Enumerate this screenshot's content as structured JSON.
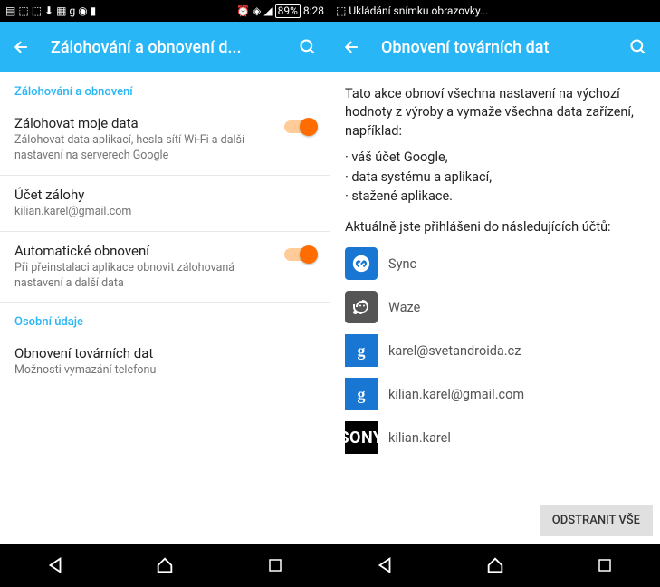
{
  "status": {
    "battery": "89%",
    "time": "8:28",
    "saving": "Ukládání snímku obrazovky..."
  },
  "left": {
    "title": "Zálohování a obnovení d...",
    "cat1": "Zálohování a obnovení",
    "backup": {
      "title": "Zálohovat moje data",
      "desc": "Zálohovat data aplikací, hesla sítí Wi-Fi a další nastavení na serverech Google"
    },
    "account": {
      "title": "Účet zálohy",
      "desc": "kilian.karel@gmail.com"
    },
    "autorestore": {
      "title": "Automatické obnovení",
      "desc": "Při přeinstalaci aplikace obnovit zálohovaná nastavení a další data"
    },
    "cat2": "Osobní údaje",
    "factory": {
      "title": "Obnovení továrních dat",
      "desc": "Možnosti vymazání telefonu"
    }
  },
  "right": {
    "title": "Obnovení továrních dat",
    "para": "Tato akce obnoví všechna nastavení na výchozí hodnoty z výroby a vymaže všechna data zařízení, například:",
    "b1": "· váš účet Google,",
    "b2": "· data systému a aplikací,",
    "b3": "· stažené aplikace.",
    "signed": "Aktuálně jste přihlášeni do následujících účtů:",
    "accounts": {
      "a1": "Sync",
      "a2": "Waze",
      "a3": "karel@svetandroida.cz",
      "a4": "kilian.karel@gmail.com",
      "a5": "kilian.karel"
    },
    "erase": "ODSTRANIT VŠE"
  }
}
